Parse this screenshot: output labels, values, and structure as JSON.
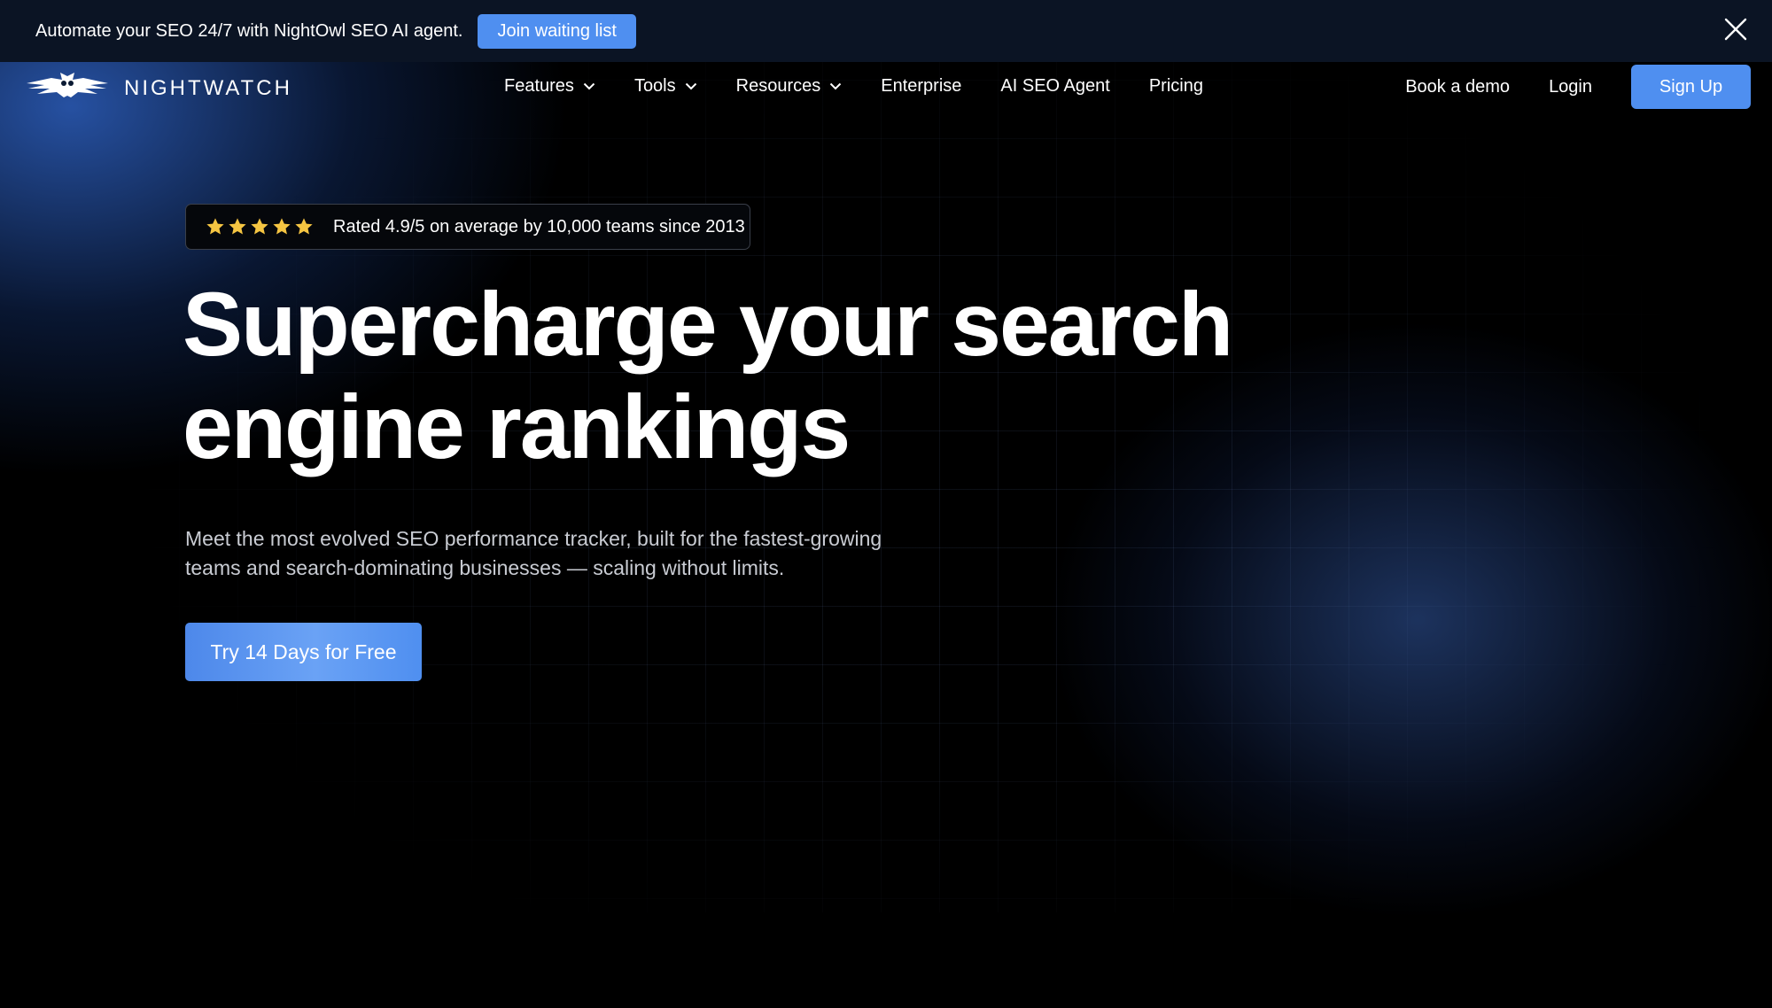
{
  "announcement": {
    "text": "Automate your SEO 24/7 with NightOwl SEO AI agent.",
    "button_label": "Join waiting list"
  },
  "nav": {
    "logo_text": "NIGHTWATCH",
    "links": [
      {
        "label": "Features",
        "has_dropdown": true
      },
      {
        "label": "Tools",
        "has_dropdown": true
      },
      {
        "label": "Resources",
        "has_dropdown": true
      },
      {
        "label": "Enterprise",
        "has_dropdown": false
      },
      {
        "label": "AI SEO Agent",
        "has_dropdown": false
      },
      {
        "label": "Pricing",
        "has_dropdown": false
      }
    ],
    "book_demo": "Book a demo",
    "login": "Login",
    "signup": "Sign Up"
  },
  "hero": {
    "rating_stars": 5,
    "rating_text": "Rated 4.9/5 on average by 10,000 teams since 2013",
    "headline_line1": "Supercharge your search",
    "headline_line2": "engine rankings",
    "subtitle_line1": "Meet the most evolved SEO performance tracker, built for the fastest-growing",
    "subtitle_line2": "teams and search-dominating businesses — scaling without limits.",
    "cta_label": "Try 14 Days for Free"
  },
  "colors": {
    "accent": "#4f8ff0",
    "star": "#f5c542",
    "announce_bg": "#0b1424"
  }
}
